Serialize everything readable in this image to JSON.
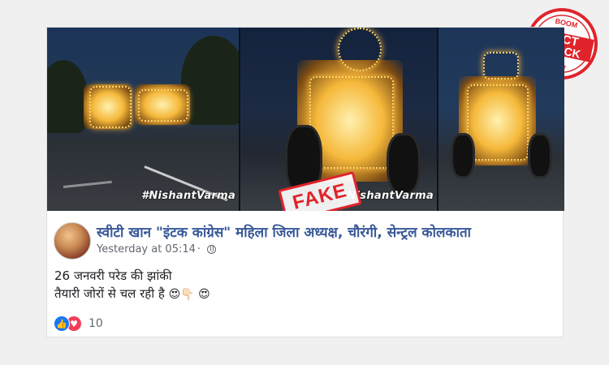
{
  "media": {
    "watermark_left": "#NishantVarma",
    "watermark_right": "#NishantVarma",
    "stamp_text": "FAKE"
  },
  "badge": {
    "top_text": "BOOM",
    "line1": "FACT",
    "line2": "CHECK",
    "color": "#e0242b"
  },
  "post": {
    "author": "स्वीटी खान \"इंटक कांग्रेस\" महिला जिला अध्यक्ष, चौरंगी, सेन्ट्रल कोलकाता",
    "timestamp": "Yesterday at 05:14",
    "line1": "26 जनवरी परेड की झांकी",
    "line2": "तैयारी जोरों से चल रही है",
    "emojis": "😍👇🏻 😍",
    "reaction_count": "10"
  },
  "colors": {
    "link": "#385898",
    "like": "#1877f2",
    "love": "#f33e58"
  }
}
